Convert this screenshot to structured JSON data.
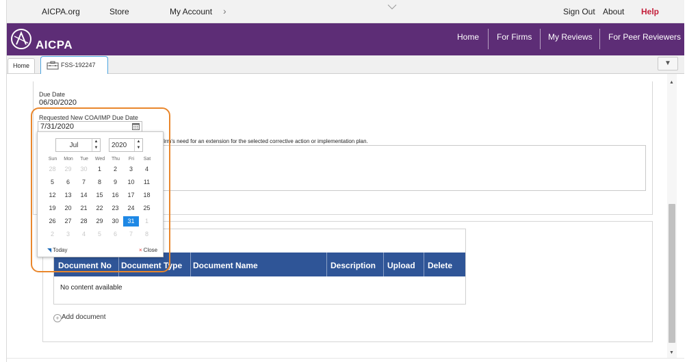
{
  "top_nav": {
    "links": [
      "AICPA.org",
      "Store",
      "My Account",
      "Sign Out",
      "About"
    ],
    "help": "Help",
    "account_chevron": "›"
  },
  "main_nav": {
    "brand": "AICPA",
    "items": [
      "Home",
      "For Firms",
      "My Reviews",
      "For Peer Reviewers"
    ]
  },
  "tabs": {
    "home": "Home",
    "active": "FSS-192247",
    "dropdown_icon": "▼"
  },
  "form": {
    "due_date_label": "Due Date",
    "due_date_value": "06/30/2020",
    "requested_label": "Requested New COA/IMP Due Date",
    "requested_value": "7/31/2020",
    "instruction_fragment": "firm's need for an extension for the selected corrective action or implementation plan."
  },
  "calendar": {
    "month": "Jul",
    "year": "2020",
    "weekdays": [
      "Sun",
      "Mon",
      "Tue",
      "Wed",
      "Thu",
      "Fri",
      "Sat"
    ],
    "weeks": [
      [
        "28",
        "29",
        "30",
        "1",
        "2",
        "3",
        "4"
      ],
      [
        "5",
        "6",
        "7",
        "8",
        "9",
        "10",
        "11"
      ],
      [
        "12",
        "13",
        "14",
        "15",
        "16",
        "17",
        "18"
      ],
      [
        "19",
        "20",
        "21",
        "22",
        "23",
        "24",
        "25"
      ],
      [
        "26",
        "27",
        "28",
        "29",
        "30",
        "31",
        "1"
      ],
      [
        "2",
        "3",
        "4",
        "5",
        "6",
        "7",
        "8"
      ]
    ],
    "selected_day": "31",
    "today_label": "Today",
    "close_label": "Close"
  },
  "documents": {
    "columns": [
      "Document No",
      "Document Type",
      "Document Name",
      "Description",
      "Upload",
      "Delete"
    ],
    "empty_text": "No content available",
    "add_label": "Add document"
  },
  "colors": {
    "nav_purple": "#5d2d76",
    "help_red": "#c41e3a",
    "table_header_blue": "#2f5597",
    "highlight_orange": "#e9862b",
    "selected_day_blue": "#1e88e5"
  },
  "icons": {
    "logo": "aicpa-logo-icon",
    "calendar": "calendar-icon",
    "tab": "case-file-icon",
    "add": "add-circle-icon"
  }
}
